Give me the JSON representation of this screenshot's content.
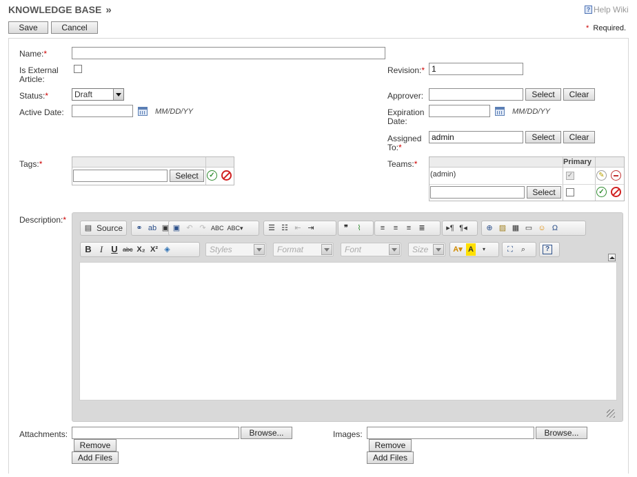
{
  "header": {
    "title": "KNOWLEDGE BASE",
    "chevron": "»",
    "help_label": "Help Wiki"
  },
  "toolbar": {
    "save_label": "Save",
    "cancel_label": "Cancel"
  },
  "required_note": {
    "star": "*",
    "text": "Required."
  },
  "form": {
    "name": {
      "label": "Name:",
      "value": ""
    },
    "is_external": {
      "label_line1": "Is External",
      "label_line2": "Article:",
      "checked": false
    },
    "revision": {
      "label": "Revision:",
      "value": "1"
    },
    "status": {
      "label": "Status:",
      "value": "Draft"
    },
    "approver": {
      "label": "Approver:",
      "value": "",
      "select_label": "Select",
      "clear_label": "Clear"
    },
    "active_date": {
      "label": "Active Date:",
      "value": "",
      "format": "MM/DD/YY"
    },
    "expiration_date": {
      "label_line1": "Expiration",
      "label_line2": "Date:",
      "value": "",
      "format": "MM/DD/YY"
    },
    "assigned_to": {
      "label_line1": "Assigned",
      "label_line2": "To:",
      "value": "admin",
      "select_label": "Select",
      "clear_label": "Clear"
    },
    "tags": {
      "label": "Tags:",
      "value": "",
      "select_label": "Select"
    },
    "teams": {
      "label": "Teams:",
      "primary_header": "Primary",
      "rows": [
        {
          "name": "(admin)",
          "primary": true
        }
      ],
      "select_label": "Select"
    },
    "description": {
      "label": "Description:"
    },
    "attachments": {
      "label": "Attachments:",
      "browse_label": "Browse...",
      "remove_label": "Remove",
      "add_label": "Add Files"
    },
    "images": {
      "label": "Images:",
      "browse_label": "Browse...",
      "remove_label": "Remove",
      "add_label": "Add Files"
    }
  },
  "editor": {
    "source_label": "Source",
    "styles_placeholder": "Styles",
    "format_placeholder": "Format",
    "font_placeholder": "Font",
    "size_placeholder": "Size",
    "bold": "B",
    "italic": "I",
    "underline": "U",
    "strike": "abc",
    "subscript": "X₂",
    "superscript": "X²"
  }
}
